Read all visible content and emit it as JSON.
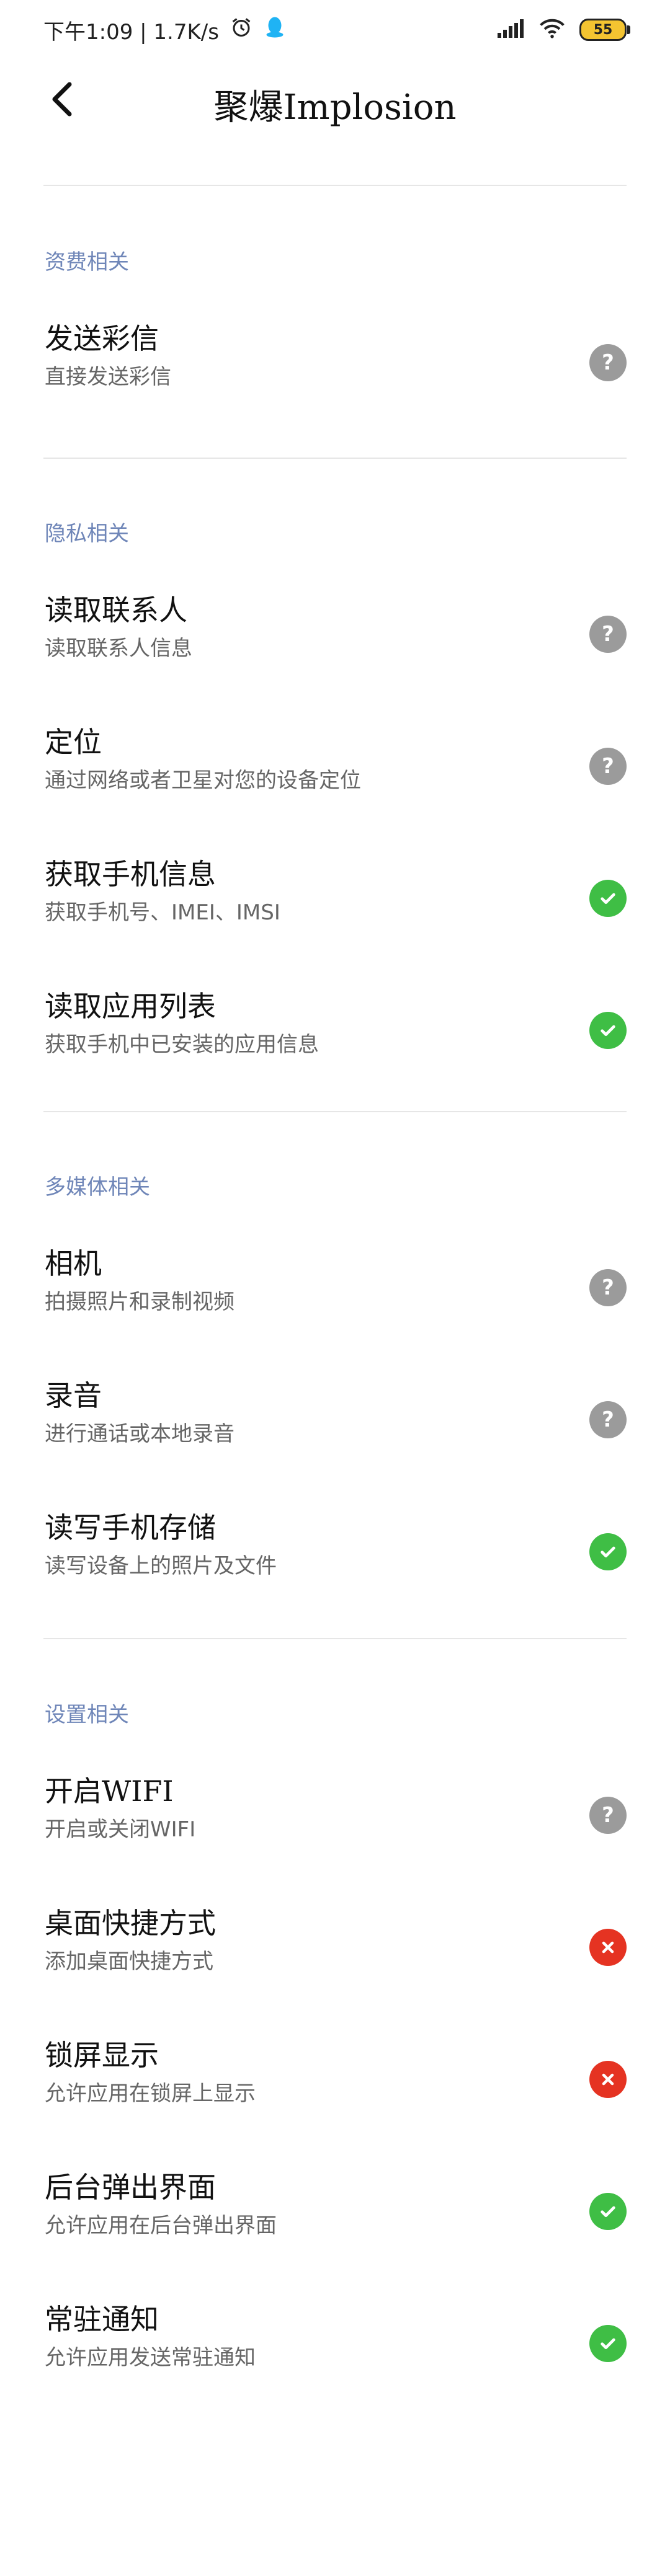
{
  "status_bar": {
    "time_speed": "下午1:09 | 1.7K/s",
    "battery": "55"
  },
  "header": {
    "title": "聚爆Implosion"
  },
  "sections": [
    {
      "title": "资费相关",
      "items": [
        {
          "title": "发送彩信",
          "desc": "直接发送彩信",
          "status": "help"
        }
      ]
    },
    {
      "title": "隐私相关",
      "items": [
        {
          "title": "读取联系人",
          "desc": "读取联系人信息",
          "status": "help"
        },
        {
          "title": "定位",
          "desc": "通过网络或者卫星对您的设备定位",
          "status": "help"
        },
        {
          "title": "获取手机信息",
          "desc": "获取手机号、IMEI、IMSI",
          "status": "allowed"
        },
        {
          "title": "读取应用列表",
          "desc": "获取手机中已安装的应用信息",
          "status": "allowed"
        }
      ]
    },
    {
      "title": "多媒体相关",
      "items": [
        {
          "title": "相机",
          "desc": "拍摄照片和录制视频",
          "status": "help"
        },
        {
          "title": "录音",
          "desc": "进行通话或本地录音",
          "status": "help"
        },
        {
          "title": "读写手机存储",
          "desc": "读写设备上的照片及文件",
          "status": "allowed"
        }
      ]
    },
    {
      "title": "设置相关",
      "items": [
        {
          "title": "开启WIFI",
          "desc": "开启或关闭WIFI",
          "status": "help"
        },
        {
          "title": "桌面快捷方式",
          "desc": "添加桌面快捷方式",
          "status": "denied"
        },
        {
          "title": "锁屏显示",
          "desc": "允许应用在锁屏上显示",
          "status": "denied"
        },
        {
          "title": "后台弹出界面",
          "desc": "允许应用在后台弹出界面",
          "status": "allowed"
        },
        {
          "title": "常驻通知",
          "desc": "允许应用发送常驻通知",
          "status": "allowed"
        }
      ]
    }
  ],
  "icons": {
    "help": "question-icon",
    "allowed": "check-icon",
    "denied": "cross-icon"
  },
  "colors": {
    "allowed": "#3fbe45",
    "denied": "#e53322",
    "help": "#9b9b9b",
    "section_title": "#6f86b8"
  }
}
